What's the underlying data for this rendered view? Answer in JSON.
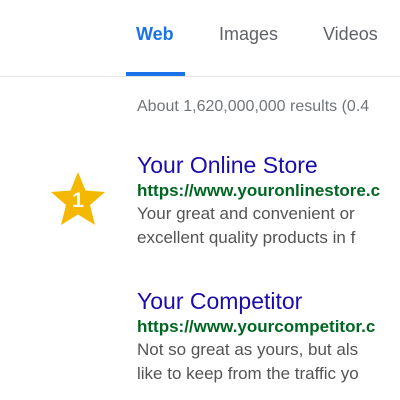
{
  "tabs": {
    "items": [
      {
        "label": "Web",
        "active": true
      },
      {
        "label": "Images",
        "active": false
      },
      {
        "label": "Videos",
        "active": false
      }
    ]
  },
  "results_info": {
    "count_text": "About 1,620,000,000 results (0.4"
  },
  "rank_badge": {
    "number": "1",
    "icon": "star-icon",
    "color": "#F5B800"
  },
  "results": [
    {
      "title": "Your Online Store",
      "url": "https://www.youronlinestore.c",
      "snippet_lines": [
        "Your great and convenient or",
        "excellent quality products in f"
      ]
    },
    {
      "title": "Your Competitor",
      "url": "https://www.yourcompetitor.c",
      "snippet_lines": [
        "Not so great as yours, but als",
        "like to keep from the traffic yo"
      ]
    }
  ],
  "colors": {
    "accent": "#1A73E8",
    "link": "#1A0DAB",
    "url": "#006621",
    "snippet": "#545454",
    "meta": "#70757A"
  }
}
